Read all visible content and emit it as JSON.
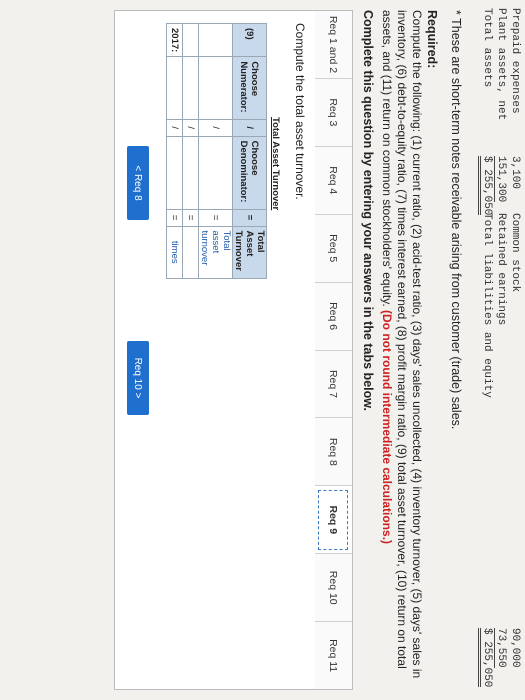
{
  "balance_sheet": {
    "rows": [
      {
        "label": "Prepaid expenses",
        "value": "3,100",
        "right_label": "Common stock",
        "right_value": "90,000"
      },
      {
        "label": "Plant assets, net",
        "value": "151,300",
        "right_label": "Retained earnings",
        "right_value": "73,550"
      },
      {
        "label": "Total assets",
        "value": "$ 255,050",
        "right_label": "Total liabilities and equity",
        "right_value": "$ 255,050"
      }
    ]
  },
  "footnote": "* These are short-term notes receivable arising from customer (trade) sales.",
  "required": {
    "heading": "Required:",
    "body": "Compute the following: (1) current ratio, (2) acid-test ratio, (3) days' sales uncollected, (4) inventory turnover, (5) days' sales in inventory, (6) debt-to-equity ratio, (7) times interest earned, (8) profit margin ratio, (9) total asset turnover, (10) return on total assets, and (11) return on common stockholders' equity.",
    "emphasis": "(Do not round intermediate calculations.)"
  },
  "instruction": "Complete this question by entering your answers in the tabs below.",
  "tabs": [
    {
      "label": "Req 1 and 2",
      "active": false
    },
    {
      "label": "Req 3",
      "active": false
    },
    {
      "label": "Req 4",
      "active": false
    },
    {
      "label": "Req 5",
      "active": false
    },
    {
      "label": "Req 6",
      "active": false
    },
    {
      "label": "Req 7",
      "active": false
    },
    {
      "label": "Req 8",
      "active": false
    },
    {
      "label": "Req 9",
      "active": true
    },
    {
      "label": "Req 10",
      "active": false
    },
    {
      "label": "Req 11",
      "active": false
    }
  ],
  "content": {
    "title": "Compute the total asset turnover.",
    "table": {
      "number": "(9)",
      "caption": "Total Asset Turnover",
      "col_numerator": "Choose Numerator:",
      "div": "/",
      "col_denominator": "Choose Denominator:",
      "eq": "=",
      "col_result": "Total Asset Turnover",
      "row1_result": "Total asset turnover",
      "row3_label": "2017:",
      "row3_result": "times"
    }
  },
  "nav": {
    "prev": "< Req 8",
    "next": "Req 10 >"
  }
}
